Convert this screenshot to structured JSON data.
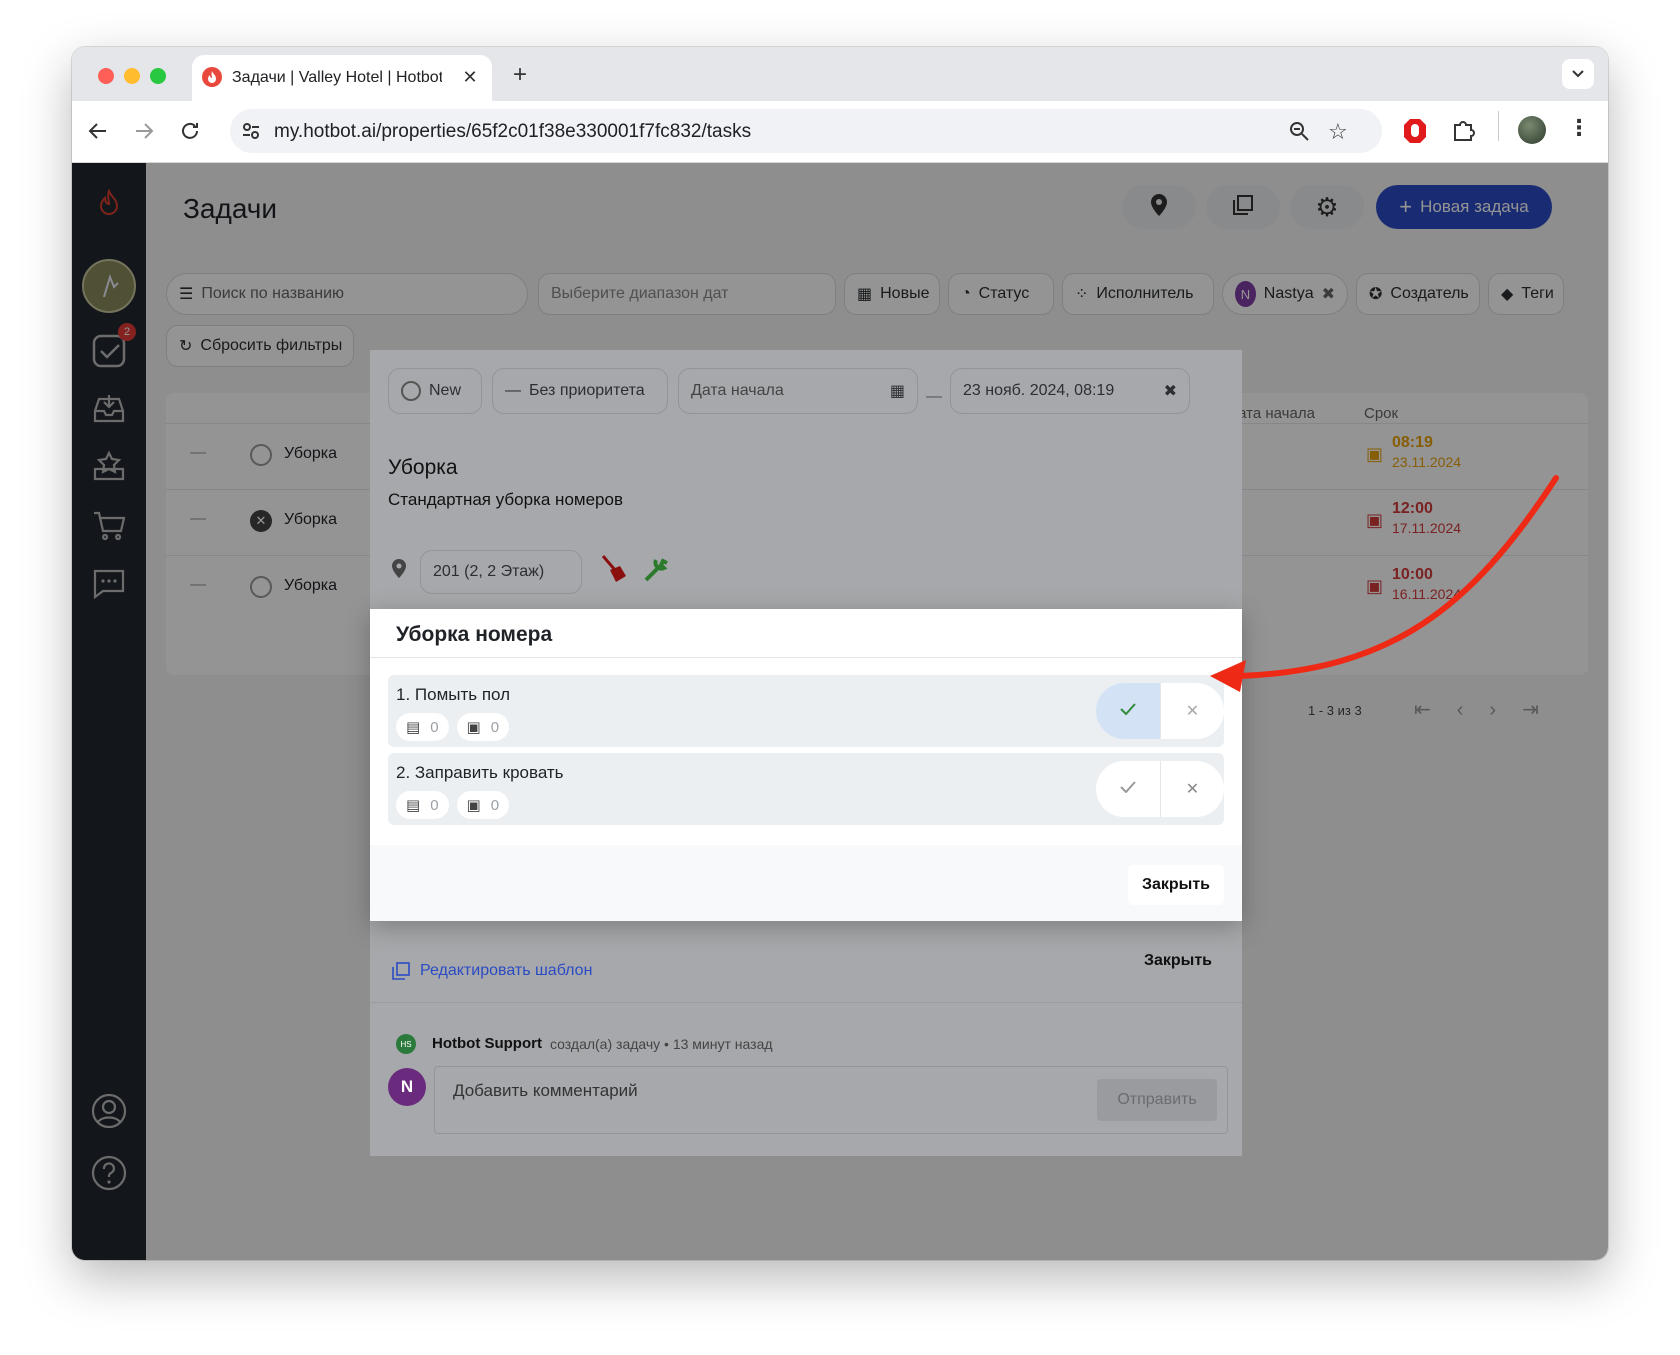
{
  "browser": {
    "tab_title": "Задачи | Valley Hotel | Hotbot",
    "url": "my.hotbot.ai/properties/65f2c01f38e330001f7fc832/tasks"
  },
  "sidebar": {
    "tasks_badge": "2"
  },
  "header": {
    "title": "Задачи",
    "new_task_label": "Новая задача"
  },
  "filters": {
    "search_placeholder": "Поиск по названию",
    "date_range_placeholder": "Выберите диапазон дат",
    "new_label": "Новые",
    "status_label": "Статус",
    "assignee_label": "Исполнитель",
    "user_chip_initial": "N",
    "user_chip_label": "Nastya",
    "creator_label": "Создатель",
    "tags_label": "Теги",
    "reset_label": "Сбросить фильтры"
  },
  "table": {
    "col_start": "Дата начала",
    "col_due": "Срок",
    "rows": [
      {
        "name": "Уборка",
        "due_time": "08:19",
        "due_date": "23.11.2024",
        "due_color": "#e8a20c"
      },
      {
        "name": "Уборка",
        "due_time": "12:00",
        "due_date": "17.11.2024",
        "due_color": "#d33b3b"
      },
      {
        "name": "Уборка",
        "due_time": "10:00",
        "due_date": "16.11.2024",
        "due_color": "#d33b3b"
      }
    ],
    "pagination": "1 - 3 из 3"
  },
  "task_dialog": {
    "status": "New",
    "priority": "Без приоритета",
    "start_placeholder": "Дата начала",
    "due_value": "23 нояб. 2024, 08:19",
    "title": "Уборка",
    "description": "Стандартная уборка номеров",
    "location": "201 (2, 2 Этаж)",
    "edit_template": "Редактировать шаблон",
    "close_label": "Закрыть",
    "activity_author_initials": "HS",
    "activity_author": "Hotbot Support",
    "activity_text": "создал(а) задачу • 13 минут назад",
    "comment_avatar": "N",
    "comment_placeholder": "Добавить комментарий",
    "send_label": "Отправить"
  },
  "checklist_dialog": {
    "title": "Уборка номера",
    "items": [
      {
        "label": "1. Помыть пол",
        "comments": "0",
        "photos": "0",
        "state": "done"
      },
      {
        "label": "2. Заправить кровать",
        "comments": "0",
        "photos": "0",
        "state": "none"
      }
    ],
    "close_label": "Закрыть"
  },
  "colors": {
    "accent": "#2b4bc4",
    "success": "#2e8b3a",
    "annotation_arrow": "#ee2a16"
  }
}
